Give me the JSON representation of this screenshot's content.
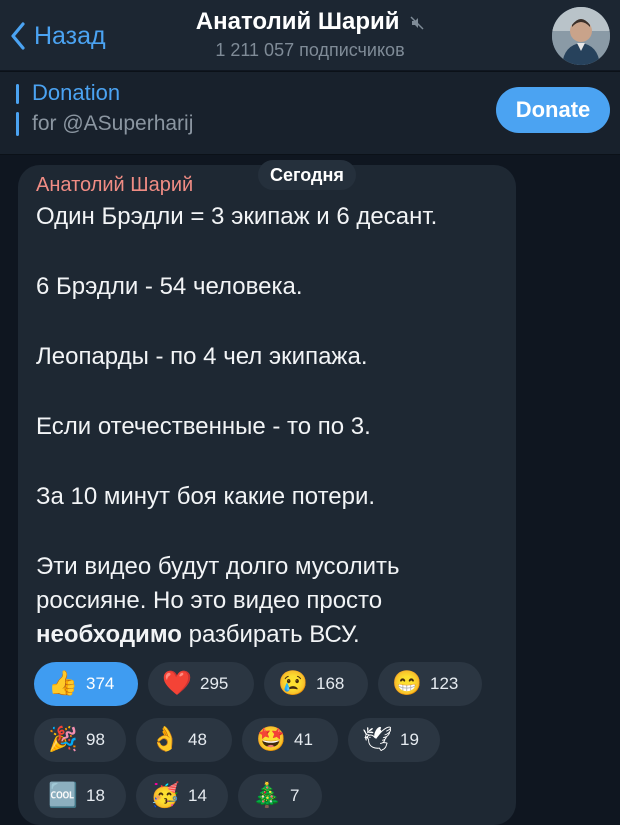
{
  "header": {
    "back_label": "Назад",
    "channel_name": "Анатолий Шарий",
    "subscribers": "1 211 057 подписчиков"
  },
  "pinned": {
    "title": "Donation",
    "subtitle": "for @ASuperharij",
    "button": "Donate"
  },
  "message": {
    "date": "Сегодня",
    "author": "Анатолий Шарий",
    "lines": [
      "Один Брэдли = 3 экипаж и 6 десант.",
      "6 Брэдли -  54 человека.",
      " Леопарды - по 4 чел экипажа.",
      "Если отечественные - то по 3.",
      "За 10 минут боя какие потери.",
      "Эти видео будут долго мусолить",
      "россияне. Но это видео просто"
    ],
    "last_bold": "необходимо",
    "last_rest": " разбирать ВСУ."
  },
  "reactions": [
    {
      "emoji": "👍",
      "count": "374",
      "name": "thumbs-up-icon"
    },
    {
      "emoji": "❤️",
      "count": "295",
      "name": "heart-icon"
    },
    {
      "emoji": "😢",
      "count": "168",
      "name": "crying-face-icon"
    },
    {
      "emoji": "😁",
      "count": "123",
      "name": "grinning-face-icon"
    },
    {
      "emoji": "🎉",
      "count": "98",
      "name": "party-popper-icon"
    },
    {
      "emoji": "👌",
      "count": "48",
      "name": "ok-hand-icon"
    },
    {
      "emoji": "🤩",
      "count": "41",
      "name": "star-struck-icon"
    },
    {
      "emoji": "🕊",
      "count": "19",
      "name": "dove-icon"
    },
    {
      "emoji": "🆒",
      "count": "18",
      "name": "cool-icon"
    },
    {
      "emoji": "🥳",
      "count": "14",
      "name": "partying-face-icon"
    },
    {
      "emoji": "🎄",
      "count": "7",
      "name": "christmas-tree-icon"
    }
  ],
  "colors": {
    "accent": "#4ba3f2",
    "author": "#f08c84",
    "background": "#0f1620",
    "bubble": "#1e2833"
  }
}
